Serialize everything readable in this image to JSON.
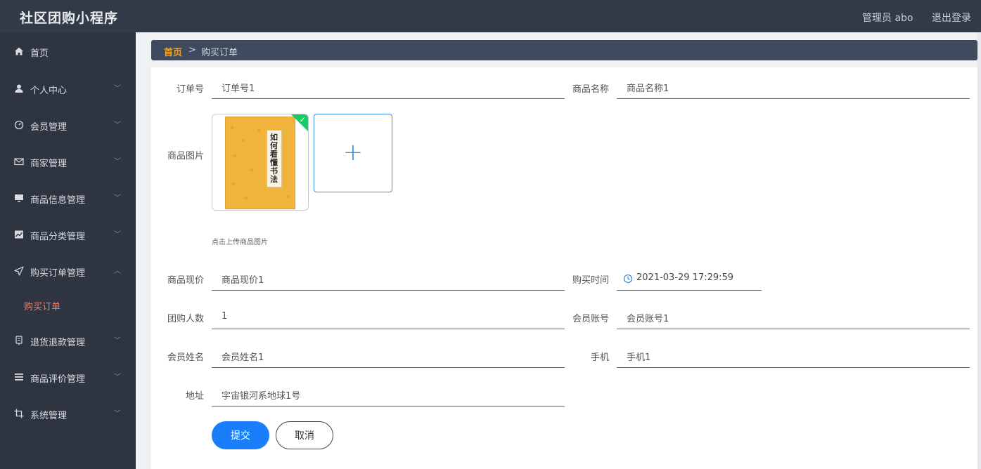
{
  "app": {
    "title": "社区团购小程序",
    "user_label": "管理员 abo",
    "logout_label": "退出登录"
  },
  "sidebar": {
    "items": [
      {
        "label": "首页",
        "icon": "home-icon",
        "arrow": ""
      },
      {
        "label": "个人中心",
        "icon": "user-icon",
        "arrow": "﹀"
      },
      {
        "label": "会员管理",
        "icon": "gauge-icon",
        "arrow": "﹀"
      },
      {
        "label": "商家管理",
        "icon": "mail-icon",
        "arrow": "﹀"
      },
      {
        "label": "商品信息管理",
        "icon": "monitor-icon",
        "arrow": "﹀"
      },
      {
        "label": "商品分类管理",
        "icon": "chart-icon",
        "arrow": "﹀"
      },
      {
        "label": "购买订单管理",
        "icon": "send-icon",
        "arrow": "︿"
      },
      {
        "label": "退货退款管理",
        "icon": "receipt-icon",
        "arrow": "﹀"
      },
      {
        "label": "商品评价管理",
        "icon": "list-icon",
        "arrow": "﹀"
      },
      {
        "label": "系统管理",
        "icon": "crop-icon",
        "arrow": "﹀"
      }
    ],
    "active_sub": "购买订单"
  },
  "breadcrumb": {
    "home": "首页",
    "separator": ">",
    "current": "购买订单"
  },
  "form": {
    "order_no": {
      "label": "订单号",
      "value": "订单号1"
    },
    "product_name": {
      "label": "商品名称",
      "value": "商品名称1"
    },
    "product_image": {
      "label": "商品图片",
      "cover_title": "如何看懂书法",
      "upload_tip": "点击上传商品图片"
    },
    "price": {
      "label": "商品现价",
      "value": "商品现价1"
    },
    "purchase_time": {
      "label": "购买时间",
      "value": "2021-03-29 17:29:59"
    },
    "group_count": {
      "label": "团购人数",
      "value": "1"
    },
    "member_account": {
      "label": "会员账号",
      "value": "会员账号1"
    },
    "member_name": {
      "label": "会员姓名",
      "value": "会员姓名1"
    },
    "phone": {
      "label": "手机",
      "value": "手机1"
    },
    "address": {
      "label": "地址",
      "value": "宇宙银河系地球1号"
    }
  },
  "buttons": {
    "submit": "提交",
    "cancel": "取消"
  },
  "colors": {
    "topbar": "#313a46",
    "sidebar": "#2f3540",
    "accent": "#1a7efb",
    "breadcrumb_home": "#f5a623",
    "active_sub": "#ff7d5c"
  }
}
